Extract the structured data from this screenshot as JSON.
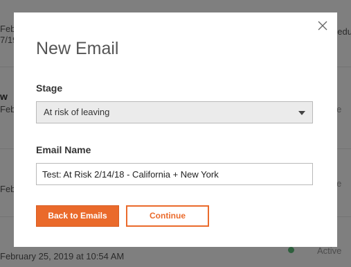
{
  "background": {
    "rows": [
      {
        "date_partial": "Feb",
        "date_partial2": "7/19",
        "status_partial": "hedule"
      },
      {
        "title_partial": "w",
        "date_partial": "Feb",
        "status": "Active"
      },
      {
        "date_partial": "Feb",
        "status": "Active"
      },
      {
        "date": "February 25, 2019 at 10:54 AM",
        "status": "Active"
      }
    ]
  },
  "modal": {
    "title": "New Email",
    "stage_label": "Stage",
    "stage_value": "At risk of leaving",
    "email_name_label": "Email Name",
    "email_name_value": "Test: At Risk 2/14/18 - California + New York",
    "back_button": "Back to Emails",
    "continue_button": "Continue"
  },
  "colors": {
    "accent": "#ea6a2b",
    "status_green": "#5cbf7a"
  }
}
